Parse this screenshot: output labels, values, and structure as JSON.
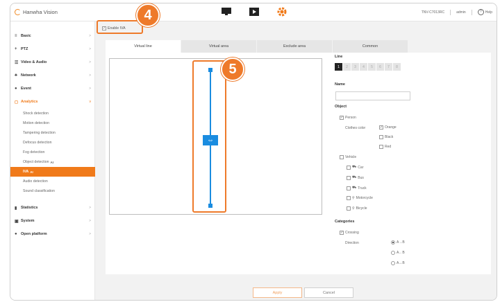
{
  "app": {
    "brand": "Hanwha Vision",
    "device": "TNV-C7013RC",
    "user": "admin",
    "help": "Help"
  },
  "topbar_icons": [
    "monitor-icon",
    "playback-icon",
    "settings-gear-icon"
  ],
  "sidebar": {
    "items": [
      {
        "label": "Basic",
        "icon": "≡"
      },
      {
        "label": "PTZ",
        "icon": "+"
      },
      {
        "label": "Video & Audio",
        "icon": "☰"
      },
      {
        "label": "Network",
        "icon": "♣"
      },
      {
        "label": "Event",
        "icon": "●"
      },
      {
        "label": "Analytics",
        "icon": "◻"
      }
    ],
    "analytics_sub": [
      "Shock detection",
      "Motion detection",
      "Tampering detection",
      "Defocus detection",
      "Fog detection",
      "Object detection",
      "IVA",
      "Audio detection",
      "Sound classification"
    ],
    "ai_tag": "AI",
    "bottom_items": [
      {
        "label": "Statistics",
        "icon": "▮"
      },
      {
        "label": "System",
        "icon": "▣"
      },
      {
        "label": "Open platform",
        "icon": "●"
      }
    ]
  },
  "content": {
    "enable_label": "Enable IVA",
    "tabs": [
      "Virtual line",
      "Virtual area",
      "Exclude area",
      "Common"
    ],
    "line_label": "Line",
    "line_numbers": [
      "1",
      "2",
      "3",
      "4",
      "5",
      "6",
      "7",
      "8"
    ],
    "name_label": "Name",
    "object_label": "Object",
    "person_label": "Person",
    "clothes_label": "Clothes color",
    "colors": [
      "Orange",
      "Black",
      "Red"
    ],
    "vehicle_label": "Vehicle",
    "vehicles": [
      "Car",
      "Bus",
      "Truck",
      "Motorcycle",
      "Bicycle"
    ],
    "categories_label": "Categories",
    "crossing_label": "Crossing",
    "direction_label": "Direction",
    "directions": [
      "A→B",
      "A←B",
      "A↔B"
    ],
    "apply_label": "Apply",
    "cancel_label": "Cancel"
  },
  "callouts": {
    "first": "4",
    "second": "5"
  },
  "colors": {
    "accent": "#f07a1a",
    "line": "#1a8ce0"
  }
}
